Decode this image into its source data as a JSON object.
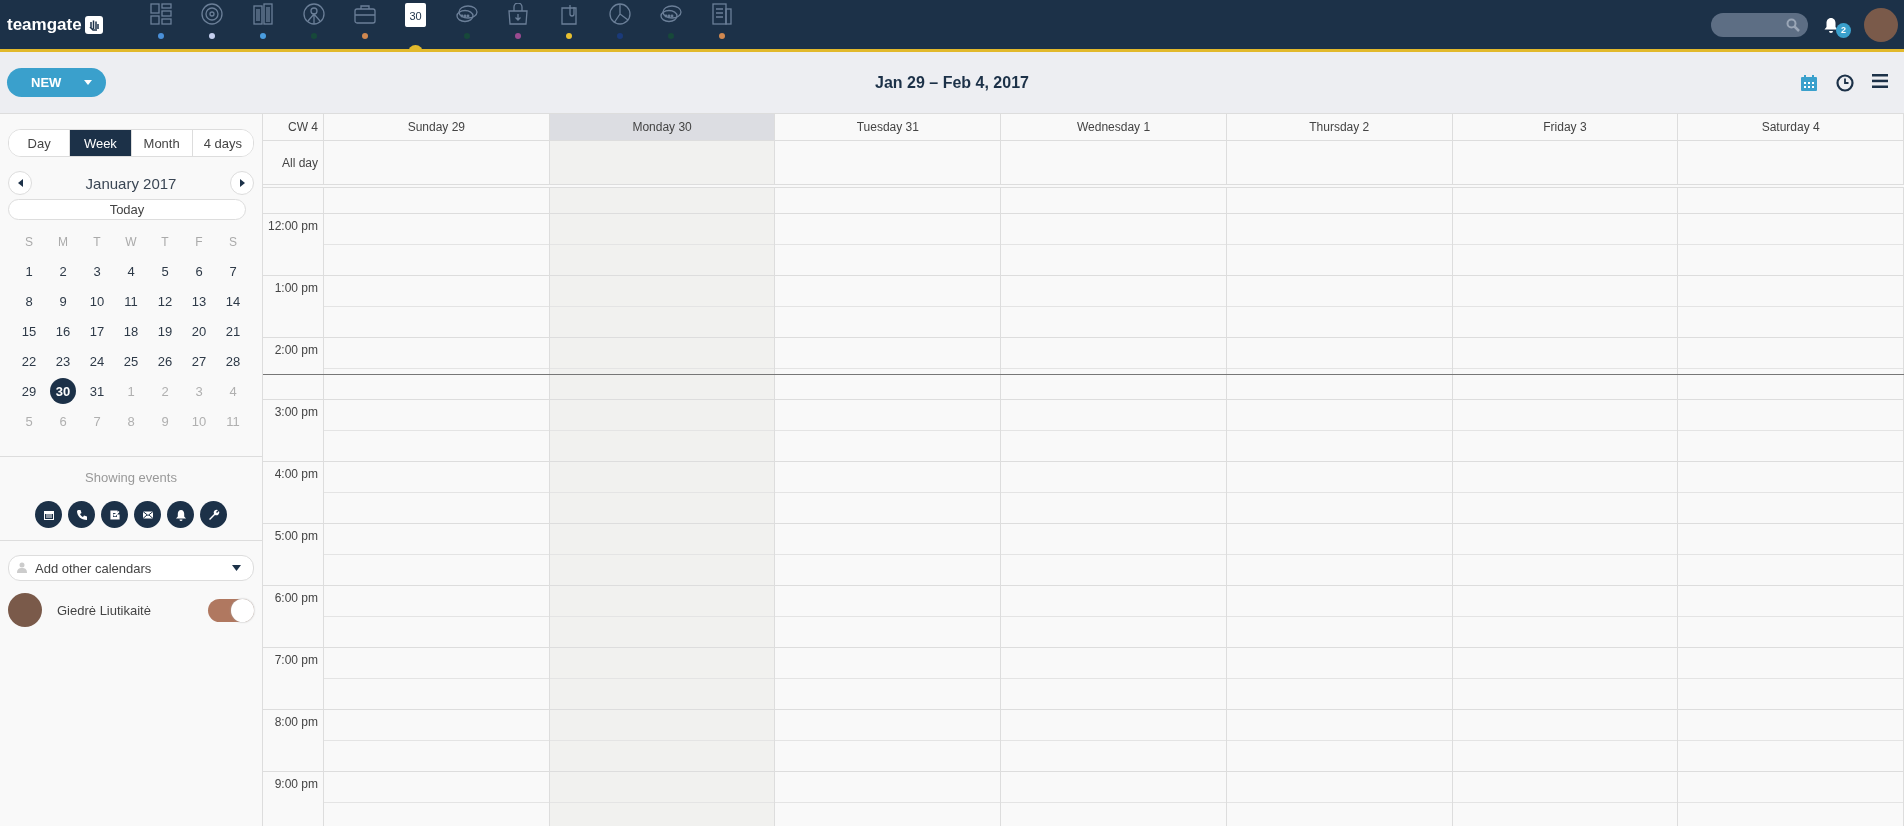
{
  "app": {
    "logo": "teamgate"
  },
  "nav": [
    {
      "kind": "dashboard",
      "color": "#4a90d9",
      "selected": false
    },
    {
      "kind": "target",
      "color": "#c5d0f0",
      "selected": false
    },
    {
      "kind": "building",
      "color": "#4a9de0",
      "selected": false
    },
    {
      "kind": "person",
      "color": "#17483a",
      "selected": false
    },
    {
      "kind": "briefcase",
      "color": "#d08850",
      "selected": false
    },
    {
      "kind": "calendar",
      "label": "30",
      "selected": true
    },
    {
      "kind": "chat",
      "color": "#17483a",
      "selected": false
    },
    {
      "kind": "bag",
      "color": "#9a4a90",
      "selected": false
    },
    {
      "kind": "clip",
      "color": "#e8c030",
      "selected": false
    },
    {
      "kind": "pie",
      "color": "#1a3a7a",
      "selected": false
    },
    {
      "kind": "chat",
      "color": "#17483a",
      "selected": false
    },
    {
      "kind": "report",
      "color": "#d08850",
      "selected": false
    }
  ],
  "notifications": {
    "count": "2"
  },
  "toolbar": {
    "new_button": "NEW",
    "title": "Jan 29 – Feb 4, 2017",
    "views": [
      {
        "kind": "calendar",
        "selected": true
      },
      {
        "kind": "clock",
        "selected": false
      },
      {
        "kind": "list",
        "selected": false
      }
    ]
  },
  "view_tabs": [
    {
      "label": "Day",
      "selected": false
    },
    {
      "label": "Week",
      "selected": true
    },
    {
      "label": "Month",
      "selected": false
    },
    {
      "label": "4 days",
      "selected": false
    }
  ],
  "mini_calendar": {
    "month": "January 2017",
    "today_button": "Today",
    "weekdays": [
      "S",
      "M",
      "T",
      "W",
      "T",
      "F",
      "S"
    ],
    "weeks": [
      [
        {
          "day": "1",
          "muted": false,
          "selected": false
        },
        {
          "day": "2",
          "muted": false,
          "selected": false
        },
        {
          "day": "3",
          "muted": false,
          "selected": false
        },
        {
          "day": "4",
          "muted": false,
          "selected": false
        },
        {
          "day": "5",
          "muted": false,
          "selected": false
        },
        {
          "day": "6",
          "muted": false,
          "selected": false
        },
        {
          "day": "7",
          "muted": false,
          "selected": false
        }
      ],
      [
        {
          "day": "8",
          "muted": false,
          "selected": false
        },
        {
          "day": "9",
          "muted": false,
          "selected": false
        },
        {
          "day": "10",
          "muted": false,
          "selected": false
        },
        {
          "day": "11",
          "muted": false,
          "selected": false
        },
        {
          "day": "12",
          "muted": false,
          "selected": false
        },
        {
          "day": "13",
          "muted": false,
          "selected": false
        },
        {
          "day": "14",
          "muted": false,
          "selected": false
        }
      ],
      [
        {
          "day": "15",
          "muted": false,
          "selected": false
        },
        {
          "day": "16",
          "muted": false,
          "selected": false
        },
        {
          "day": "17",
          "muted": false,
          "selected": false
        },
        {
          "day": "18",
          "muted": false,
          "selected": false
        },
        {
          "day": "19",
          "muted": false,
          "selected": false
        },
        {
          "day": "20",
          "muted": false,
          "selected": false
        },
        {
          "day": "21",
          "muted": false,
          "selected": false
        }
      ],
      [
        {
          "day": "22",
          "muted": false,
          "selected": false
        },
        {
          "day": "23",
          "muted": false,
          "selected": false
        },
        {
          "day": "24",
          "muted": false,
          "selected": false
        },
        {
          "day": "25",
          "muted": false,
          "selected": false
        },
        {
          "day": "26",
          "muted": false,
          "selected": false
        },
        {
          "day": "27",
          "muted": false,
          "selected": false
        },
        {
          "day": "28",
          "muted": false,
          "selected": false
        }
      ],
      [
        {
          "day": "29",
          "muted": false,
          "selected": false
        },
        {
          "day": "30",
          "muted": false,
          "selected": true
        },
        {
          "day": "31",
          "muted": false,
          "selected": false
        },
        {
          "day": "1",
          "muted": true,
          "selected": false
        },
        {
          "day": "2",
          "muted": true,
          "selected": false
        },
        {
          "day": "3",
          "muted": true,
          "selected": false
        },
        {
          "day": "4",
          "muted": true,
          "selected": false
        }
      ],
      [
        {
          "day": "5",
          "muted": true,
          "selected": false
        },
        {
          "day": "6",
          "muted": true,
          "selected": false
        },
        {
          "day": "7",
          "muted": true,
          "selected": false
        },
        {
          "day": "8",
          "muted": true,
          "selected": false
        },
        {
          "day": "9",
          "muted": true,
          "selected": false
        },
        {
          "day": "10",
          "muted": true,
          "selected": false
        },
        {
          "day": "11",
          "muted": true,
          "selected": false
        }
      ]
    ]
  },
  "event_filters": {
    "label": "Showing events",
    "items": [
      {
        "kind": "calendar"
      },
      {
        "kind": "phone"
      },
      {
        "kind": "task"
      },
      {
        "kind": "mail"
      },
      {
        "kind": "bell"
      },
      {
        "kind": "wrench"
      }
    ]
  },
  "other_calendars": {
    "placeholder": "Add other calendars",
    "users": [
      {
        "name": "Giedrė Liutikaitė",
        "on": true,
        "color": "#b07860"
      }
    ]
  },
  "week": {
    "week_label": "CW 4",
    "allday_label": "All day",
    "days": [
      {
        "label": "Sunday 29",
        "selected": false
      },
      {
        "label": "Monday 30",
        "selected": true
      },
      {
        "label": "Tuesday 31",
        "selected": false
      },
      {
        "label": "Wednesday 1",
        "selected": false
      },
      {
        "label": "Thursday 2",
        "selected": false
      },
      {
        "label": "Friday 3",
        "selected": false
      },
      {
        "label": "Saturday 4",
        "selected": false
      }
    ],
    "hours": [
      {
        "label": "12:00 pm"
      },
      {
        "label": "1:00 pm"
      },
      {
        "label": "2:00 pm",
        "current_time": true
      },
      {
        "label": "3:00 pm"
      },
      {
        "label": "4:00 pm"
      },
      {
        "label": "5:00 pm"
      },
      {
        "label": "6:00 pm"
      },
      {
        "label": "7:00 pm"
      },
      {
        "label": "8:00 pm"
      },
      {
        "label": "9:00 pm"
      }
    ]
  }
}
